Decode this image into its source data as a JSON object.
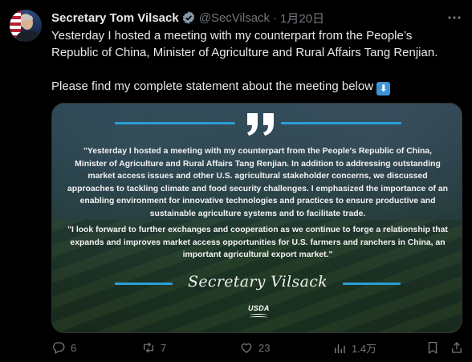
{
  "author": {
    "display_name": "Secretary Tom Vilsack",
    "handle": "@SecVilsack",
    "separator": "·",
    "date": "1月20日"
  },
  "tweet": {
    "paragraph_1": "Yesterday I hosted a meeting with my counterpart from the People’s Republic of China, Minister of Agriculture and Rural Affairs Tang Renjian.",
    "paragraph_2": "Please find my complete statement about the meeting below",
    "emoji_glyph": "⬇"
  },
  "media": {
    "statement_1": "\"Yesterday I hosted a meeting with my counterpart from the People's Republic of China, Minister of Agriculture and Rural Affairs Tang Renjian. In addition to addressing outstanding market access issues and other U.S. agricultural stakeholder concerns, we discussed approaches to tackling climate and food security challenges. I emphasized the importance of an enabling environment for innovative technologies and practices to ensure productive and sustainable agriculture systems and to facilitate trade.",
    "statement_2": "\"I look forward to further exchanges and cooperation as we continue to forge a relationship that expands and improves market access opportunities for U.S. farmers and ranchers in China, an important agricultural export market.\"",
    "signature": "Secretary Vilsack",
    "logo_text": "USDA",
    "accent_color": "#2a9fd6"
  },
  "actions": {
    "replies": "6",
    "reposts": "7",
    "likes": "23",
    "views": "1.4万"
  },
  "colors": {
    "background": "#000000",
    "text": "#e7e9ea",
    "muted": "#71767b",
    "verified": "#829aab"
  }
}
